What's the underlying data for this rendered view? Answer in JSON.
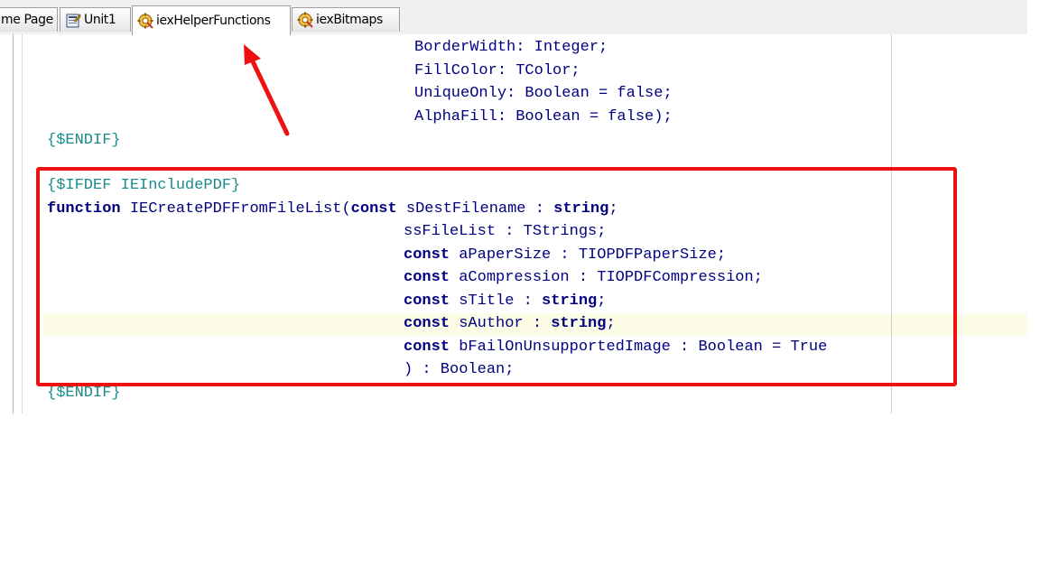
{
  "tabs": [
    {
      "label": "me Page",
      "icon": "",
      "active": false
    },
    {
      "label": "Unit1",
      "icon": "unit-icon",
      "active": false
    },
    {
      "label": "iexHelperFunctions",
      "icon": "gear-unit-icon",
      "active": true
    },
    {
      "label": "iexBitmaps",
      "icon": "gear-unit-icon",
      "active": false
    }
  ],
  "editor": {
    "lines": [
      {
        "text": "BorderWidth: Integer;"
      },
      {
        "text": "FillColor: TColor;"
      },
      {
        "text": "UniqueOnly: Boolean = false;"
      },
      {
        "text": "AlphaFill: Boolean = false);"
      },
      {
        "directive": "{$ENDIF}"
      },
      {
        "directive": "{$IFDEF IEIncludePDF}"
      },
      {
        "kw": "function",
        "text": " IECreatePDFFromFileList(",
        "kw2": "const",
        "text2": " sDestFilename : ",
        "kw3": "string",
        "text3": ";"
      },
      {
        "text": "ssFileList : TStrings;"
      },
      {
        "kw": "const",
        "text": " aPaperSize : TIOPDFPaperSize;"
      },
      {
        "kw": "const",
        "text": " aCompression : TIOPDFCompression;"
      },
      {
        "kw": "const",
        "text": " sTitle : ",
        "kw2": "string",
        "text2": ";"
      },
      {
        "kw": "const",
        "text": " sAuthor : ",
        "kw2": "string",
        "text2": ";"
      },
      {
        "kw": "const",
        "text": " bFailOnUnsupportedImage : Boolean = True"
      },
      {
        "text": ") : Boolean;"
      },
      {
        "directive": "{$ENDIF}"
      }
    ]
  },
  "colors": {
    "annotation": "#ee1111",
    "keyword": "#000080",
    "directive": "#1a8a8a",
    "current_line": "#fbfbe6"
  }
}
